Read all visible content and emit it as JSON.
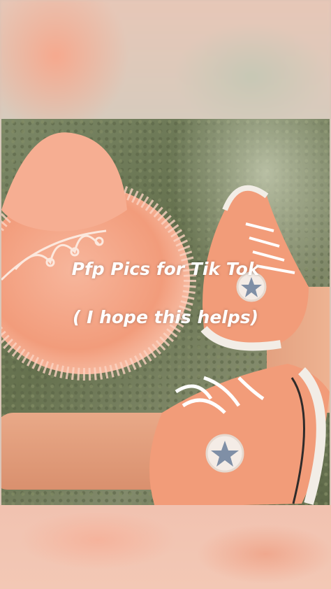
{
  "overlay": {
    "title": "Pfp Pics for Tik Tok",
    "subtitle": "( I hope this helps)"
  },
  "colors": {
    "peach": "#f2a07e",
    "grass": "#6e7a55",
    "text": "#ffffff"
  }
}
